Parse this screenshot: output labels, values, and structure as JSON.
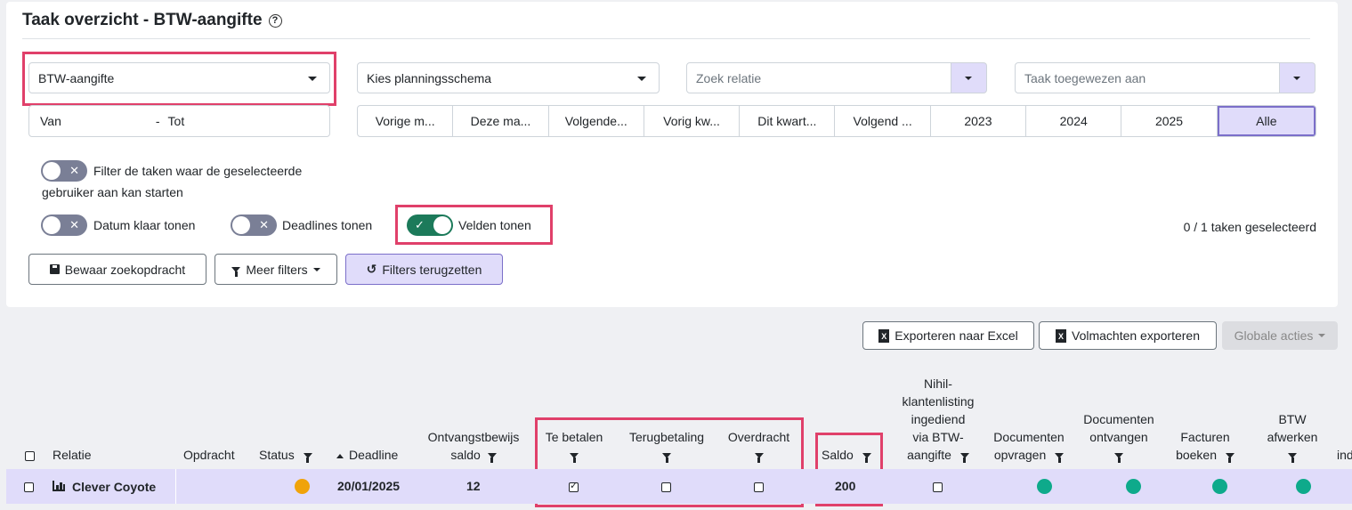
{
  "header": {
    "title": "Taak overzicht - BTW-aangifte",
    "help_icon": "?"
  },
  "filters": {
    "task_type": "BTW-aangifte",
    "planning_schema": "Kies planningsschema",
    "relation_placeholder": "Zoek relatie",
    "assignee_placeholder": "Taak toegewezen aan",
    "date_from": "Van",
    "date_sep": "-",
    "date_to": "Tot",
    "periods": [
      "Vorige m...",
      "Deze ma...",
      "Volgende...",
      "Vorig kw...",
      "Dit kwart...",
      "Volgend ...",
      "2023",
      "2024",
      "2025",
      "Alle"
    ],
    "active_period": "Alle"
  },
  "toggles": {
    "startable": {
      "label_line1": "Filter de taken waar de geselecteerde",
      "label_line2": "gebruiker aan kan starten",
      "on": false
    },
    "date_done": {
      "label": "Datum klaar tonen",
      "on": false
    },
    "deadlines": {
      "label": "Deadlines tonen",
      "on": false
    },
    "fields": {
      "label": "Velden tonen",
      "on": true
    }
  },
  "selection": {
    "count_text": "0 / 1 taken geselecteerd"
  },
  "buttons": {
    "save_search": "Bewaar zoekopdracht",
    "more_filters": "Meer filters",
    "reset_filters": "Filters terugzetten",
    "export_excel": "Exporteren naar Excel",
    "export_mandates": "Volmachten exporteren",
    "global_actions": "Globale acties"
  },
  "table": {
    "headers": {
      "relatie": "Relatie",
      "opdracht": "Opdracht",
      "status": "Status",
      "deadline": "Deadline",
      "ontvangst1": "Ontvangstbewijs",
      "ontvangst2": "saldo",
      "te_betalen": "Te betalen",
      "terugbetaling": "Terugbetaling",
      "overdracht": "Overdracht",
      "saldo": "Saldo",
      "nihil1": "Nihil-",
      "nihil2": "klantenlisting",
      "nihil3": "ingediend",
      "nihil4": "via BTW-",
      "nihil5": "aangifte",
      "doc_opvragen1": "Documenten",
      "doc_opvragen2": "opvragen",
      "doc_ontvangen1": "Documenten",
      "doc_ontvangen2": "ontvangen",
      "facturen1": "Facturen",
      "facturen2": "boeken",
      "btw1": "BTW",
      "btw2": "afwerken",
      "cut": "ind"
    },
    "row": {
      "relatie": "Clever Coyote",
      "deadline": "20/01/2025",
      "ontvangstbewijs_saldo": "12",
      "te_betalen_checked": true,
      "terugbetaling_checked": false,
      "overdracht_checked": false,
      "saldo": "200",
      "nihil_checked": false,
      "status_color": "#f0a30a",
      "step_color": "#0eaa8b"
    }
  },
  "colors": {
    "accent": "#e0dcfa",
    "highlight": "#e0406a",
    "toggle_on": "#1c7a5a"
  }
}
